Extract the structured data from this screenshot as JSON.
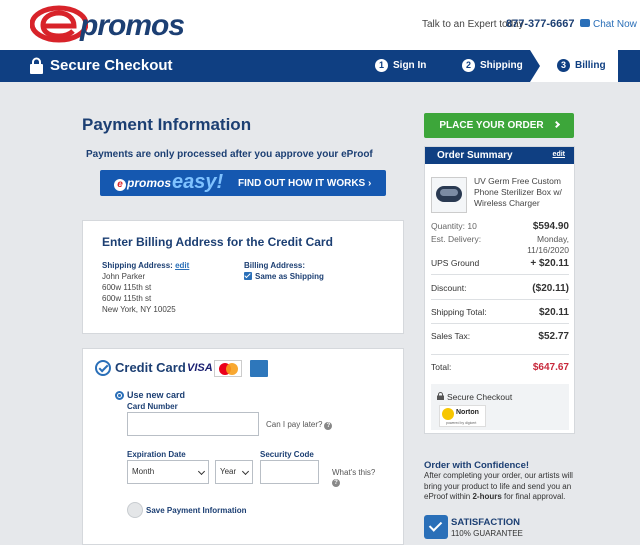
{
  "header": {
    "logo_text": "promos",
    "expert_text": "Talk to an Expert today",
    "phone": "877-377-6667",
    "chat_label": "Chat Now"
  },
  "nav": {
    "title": "Secure Checkout",
    "steps": [
      {
        "num": "1",
        "label": "Sign In"
      },
      {
        "num": "2",
        "label": "Shipping"
      },
      {
        "num": "3",
        "label": "Billing"
      }
    ],
    "active_step": "Billing"
  },
  "payment": {
    "title": "Payment Information",
    "note": "Payments are only processed after you approve your eProof",
    "banner": {
      "brand": "promos",
      "word": "easy!",
      "cta": "FIND OUT HOW IT WORKS ›"
    }
  },
  "billing": {
    "title": "Enter Billing Address for the Credit Card",
    "shipping_label": "Shipping Address:",
    "edit_label": "edit",
    "address_lines": [
      "John Parker",
      "600w 115th st",
      "600w 115th st",
      "New York, NY 10025"
    ],
    "billing_label": "Billing Address:",
    "same_as_shipping": "Same as Shipping",
    "same_as_shipping_checked": true
  },
  "credit_card": {
    "title": "Credit Card",
    "visa_label": "VISA",
    "use_new_card": "Use new card",
    "card_number_label": "Card Number",
    "card_number_value": "",
    "pay_later": "Can I pay later?",
    "expiration_label": "Expiration Date",
    "month_value": "Month",
    "year_value": "Year",
    "security_label": "Security Code",
    "security_value": "",
    "whats_this": "What's this?",
    "save_label": "Save Payment Information"
  },
  "order": {
    "place_button": "PLACE YOUR ORDER",
    "summary_title": "Order Summary",
    "edit_label": "edit",
    "product_name": "UV Germ Free Custom Phone Sterilizer Box w/ Wireless Charger",
    "quantity_label": "Quantity: 10",
    "quantity_price": "$594.90",
    "delivery_label": "Est. Delivery:",
    "delivery_value_1": "Monday,",
    "delivery_value_2": "11/16/2020",
    "shipping_method": "UPS Ground",
    "shipping_price": "+ $20.11",
    "discount_label": "Discount:",
    "discount_value": "($20.11)",
    "shipping_total_label": "Shipping Total:",
    "shipping_total_value": "$20.11",
    "tax_label": "Sales Tax:",
    "tax_value": "$52.77",
    "total_label": "Total:",
    "total_value": "$647.67",
    "secure_checkout": "Secure Checkout",
    "norton_label": "Norton",
    "norton_sub": "powered by digicert"
  },
  "confidence": {
    "title": "Order with Confidence!",
    "body_before": "After completing your order, our artists will bring your product to life and send you an eProof within ",
    "body_bold": "2-hours",
    "body_after": " for final approval.",
    "sat_title": "SATISFACTION",
    "sat_sub": "110% GUARANTEE"
  },
  "colors": {
    "brand_navy": "#0f3f82",
    "brand_red": "#d8232a",
    "cta_green": "#3da63a",
    "total_red": "#c8283b"
  }
}
